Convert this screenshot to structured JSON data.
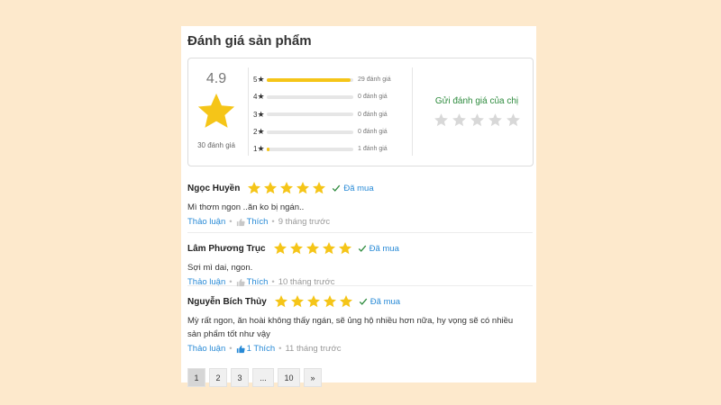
{
  "section_title": "Đánh giá sản phẩm",
  "colors": {
    "star": "#f5c518",
    "star_empty": "#d8d8d8",
    "link": "#288ad6",
    "send": "#2e8b3e",
    "background": "#fde9cc"
  },
  "summary": {
    "average": "4.9",
    "total_label": "30 đánh giá",
    "breakdown": [
      {
        "stars": "5",
        "fraction": 0.97,
        "count_label": "29 đánh giá"
      },
      {
        "stars": "4",
        "fraction": 0,
        "count_label": "0 đánh giá"
      },
      {
        "stars": "3",
        "fraction": 0,
        "count_label": "0 đánh giá"
      },
      {
        "stars": "2",
        "fraction": 0,
        "count_label": "0 đánh giá"
      },
      {
        "stars": "1",
        "fraction": 0.03,
        "count_label": "1 đánh giá"
      }
    ],
    "send_label": "Gửi đánh giá của chị",
    "send_stars": 5
  },
  "reviews": [
    {
      "name": "Ngọc Huyền",
      "rating": 5,
      "bought": "Đã mua",
      "text": "Mì thơm ngon ..ăn ko bị ngán..",
      "discuss": "Thảo luận",
      "like": "Thích",
      "time": "9 tháng trước"
    },
    {
      "name": "Lâm Phương Trục",
      "rating": 5,
      "bought": "Đã mua",
      "text": "Sợi mì dai, ngon.",
      "discuss": "Thảo luận",
      "like": "Thích",
      "time": "10 tháng trước"
    },
    {
      "name": "Nguyễn Bích Thủy",
      "rating": 5,
      "bought": "Đã mua",
      "text": "Mỳ rất ngon, ăn hoài không thấy ngán, sẽ ủng hộ nhiều hơn nữa, hy vọng sẽ có nhiều sản phẩm tốt như vậy",
      "discuss": "Thảo luận",
      "like": "1 Thích",
      "time": "11 tháng trước"
    }
  ],
  "pagination": [
    "1",
    "2",
    "3",
    "...",
    "10",
    "»"
  ],
  "icons": {
    "star": "star-icon",
    "check": "check-icon",
    "like": "thumbs-up-icon",
    "next": "next-page-icon"
  }
}
